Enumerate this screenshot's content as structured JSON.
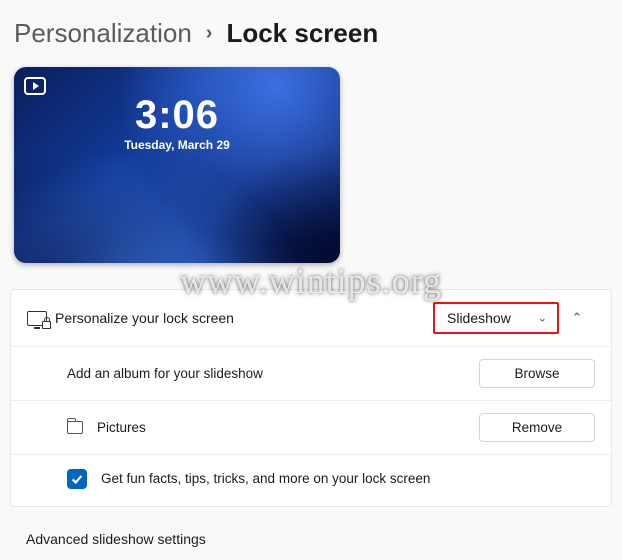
{
  "breadcrumb": {
    "parent": "Personalization",
    "current": "Lock screen"
  },
  "preview": {
    "time": "3:06",
    "date": "Tuesday, March 29"
  },
  "personalize": {
    "label": "Personalize your lock screen",
    "dropdown_value": "Slideshow"
  },
  "album": {
    "label": "Add an album for your slideshow",
    "browse": "Browse"
  },
  "folder": {
    "name": "Pictures",
    "remove": "Remove"
  },
  "facts": {
    "label": "Get fun facts, tips, tricks, and more on your lock screen"
  },
  "advanced": {
    "label": "Advanced slideshow settings"
  },
  "watermark": "www.wintips.org"
}
